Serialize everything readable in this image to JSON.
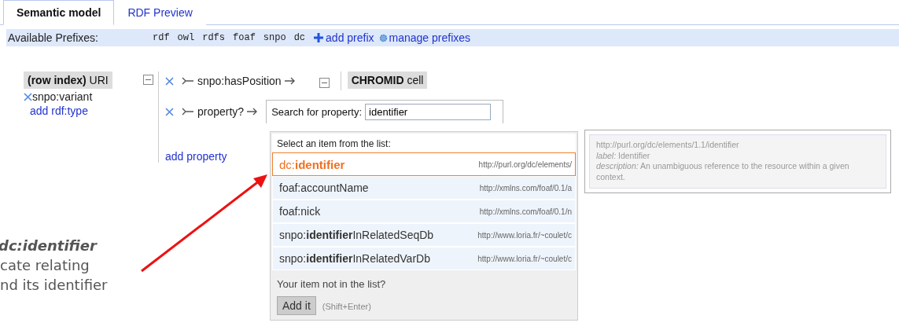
{
  "tabs": [
    {
      "label": "Semantic model",
      "selected": true
    },
    {
      "label": "RDF Preview",
      "selected": false
    }
  ],
  "prefix_bar": {
    "label": "Available Prefixes:",
    "prefixes": [
      "rdf",
      "owl",
      "rdfs",
      "foaf",
      "snpo",
      "dc"
    ],
    "links": [
      {
        "kind": "add",
        "label": "add prefix"
      },
      {
        "kind": "manage",
        "label": "manage prefixes"
      }
    ]
  },
  "root_node": {
    "label": "**(row index)** URI",
    "types": [
      "snpo:variant"
    ],
    "add_type": "add rdf:type"
  },
  "links": [
    {
      "property": "snpo:hasPosition",
      "target": "**CHROMID** cell"
    },
    {
      "property": "property?"
    }
  ],
  "add_property": "add property",
  "search": {
    "label": "Search for property:",
    "value": "identifier"
  },
  "suggestions": {
    "heading": "Select an item from the list:",
    "items": [
      {
        "name": "dc:**identifier**",
        "uri": "http://purl.org/dc/elements/",
        "selected": true
      },
      {
        "name": "foaf:accountName",
        "uri": "http://xmlns.com/foaf/0.1/a",
        "selected": false
      },
      {
        "name": "foaf:nick",
        "uri": "http://xmlns.com/foaf/0.1/n",
        "selected": false
      },
      {
        "name": "snpo:**identifier**InRelatedSeqDb",
        "uri": "http://www.loria.fr/~coulet/c",
        "selected": false
      },
      {
        "name": "snpo:**identifier**InRelatedVarDb",
        "uri": "http://www.loria.fr/~coulet/c",
        "selected": false
      }
    ],
    "not_in_list": "Your item not in the list?",
    "button": "Add it",
    "shortcut": "(Shift+Enter)"
  },
  "details": [
    "http://purl.org/dc/elements/1.1/identifier",
    "*label:* Identifier",
    "*description:* An unambiguous reference to the resource within a given context."
  ],
  "annotation": {
    "title": "dc:identifier",
    "lines": [
      "cate relating",
      "nd its identifier"
    ]
  }
}
